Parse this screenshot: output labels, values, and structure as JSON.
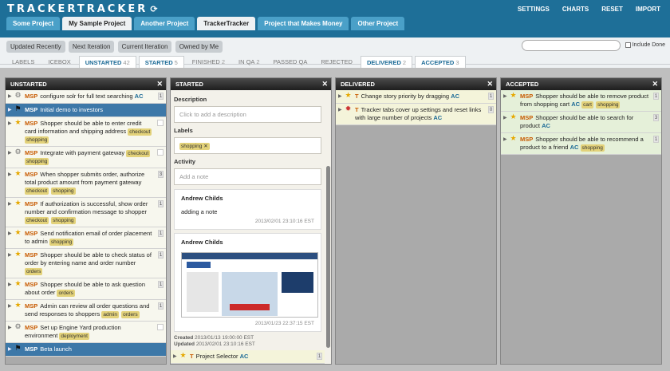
{
  "app": {
    "logo": "TRACKERTRACKER",
    "refresh_icon": "refresh-icon"
  },
  "toplinks": [
    "SETTINGS",
    "CHARTS",
    "RESET",
    "IMPORT"
  ],
  "project_tabs": [
    "Some Project",
    "My Sample Project",
    "Another Project",
    "TrackerTracker",
    "Project that Makes Money",
    "Other Project"
  ],
  "toolbar": [
    "Updated Recently",
    "Next Iteration",
    "Current Iteration",
    "Owned by Me"
  ],
  "include_done": "Include Done",
  "panel_tabs": [
    {
      "label": "LABELS",
      "count": ""
    },
    {
      "label": "ICEBOX",
      "count": ""
    },
    {
      "label": "UNSTARTED",
      "count": "42"
    },
    {
      "label": "STARTED",
      "count": "5"
    },
    {
      "label": "FINISHED",
      "count": "2"
    },
    {
      "label": "IN QA",
      "count": "2"
    },
    {
      "label": "PASSED QA",
      "count": ""
    },
    {
      "label": "REJECTED",
      "count": ""
    },
    {
      "label": "DELIVERED",
      "count": "2"
    },
    {
      "label": "ACCEPTED",
      "count": "3"
    }
  ],
  "panels": {
    "unstarted": "UNSTARTED",
    "started": "STARTED",
    "delivered": "DELIVERED",
    "accepted": "ACCEPTED"
  },
  "unstarted": [
    {
      "type": "gear",
      "pre": "MSP",
      "text": "configure solr for full text searching",
      "owner": "AC",
      "labels": [],
      "est": "1"
    },
    {
      "type": "flag",
      "pre": "MSP",
      "text": "Initial demo to investors",
      "owner": "",
      "labels": [],
      "est": "",
      "release": true
    },
    {
      "type": "star",
      "pre": "MSP",
      "text": "Shopper should be able to enter credit card information and shipping address",
      "owner": "",
      "labels": [
        "checkout",
        "shopping"
      ],
      "est": ""
    },
    {
      "type": "gear",
      "pre": "MSP",
      "text": "Integrate with payment gateway",
      "owner": "",
      "labels": [
        "checkout",
        "shopping"
      ],
      "est": ""
    },
    {
      "type": "star",
      "pre": "MSP",
      "text": "When shopper submits order, authorize total product amount from payment gateway",
      "owner": "",
      "labels": [
        "checkout",
        "shopping"
      ],
      "est": "3"
    },
    {
      "type": "star",
      "pre": "MSP",
      "text": "If authorization is successful, show order number and confirmation message to shopper",
      "owner": "",
      "labels": [
        "checkout",
        "shopping"
      ],
      "est": "1"
    },
    {
      "type": "star",
      "pre": "MSP",
      "text": "Send notification email of order placement to admin",
      "owner": "",
      "labels": [
        "shopping"
      ],
      "est": "1"
    },
    {
      "type": "star",
      "pre": "MSP",
      "text": "Shopper should be able to check status of order by entering name and order number",
      "owner": "",
      "labels": [
        "orders"
      ],
      "est": "1"
    },
    {
      "type": "star",
      "pre": "MSP",
      "text": "Shopper should be able to ask question about order",
      "owner": "",
      "labels": [
        "orders"
      ],
      "est": "1"
    },
    {
      "type": "star",
      "pre": "MSP",
      "text": "Admin can review all order questions and send responses to shoppers",
      "owner": "",
      "labels": [
        "admin",
        "orders"
      ],
      "est": "1"
    },
    {
      "type": "gear",
      "pre": "MSP",
      "text": "Set up Engine Yard production environment",
      "owner": "",
      "labels": [
        "deployment"
      ],
      "est": ""
    },
    {
      "type": "flag",
      "pre": "MSP",
      "text": "Beta launch",
      "owner": "",
      "labels": [],
      "est": "",
      "release": true
    }
  ],
  "started": {
    "description_label": "Description",
    "description_placeholder": "Click to add a description",
    "labels_label": "Labels",
    "label_tag": "shopping",
    "activity_label": "Activity",
    "note_placeholder": "Add a note",
    "notes": [
      {
        "name": "Andrew Childs",
        "text": "adding a note",
        "ts": "2013/02/01 23:10:16 EST"
      },
      {
        "name": "Andrew Childs",
        "text": "",
        "ts": "2013/01/23 22:37:15 EST"
      }
    ],
    "created_label": "Created",
    "created": "2013/01/13 19:00:00 EST",
    "updated_label": "Updated",
    "updated": "2013/02/01 23:10:16 EST",
    "story": {
      "type": "star",
      "pre": "T",
      "text": "Project Selector",
      "owner": "AC",
      "est": "1"
    }
  },
  "delivered": [
    {
      "type": "star",
      "pre": "T",
      "text": "Change story priority by dragging",
      "owner": "AC",
      "labels": [],
      "est": "1"
    },
    {
      "type": "bug",
      "pre": "T",
      "text": "Tracker tabs cover up settings and reset links with large number of projects",
      "owner": "AC",
      "labels": [],
      "est": "0"
    }
  ],
  "accepted": [
    {
      "type": "star",
      "pre": "MSP",
      "text": "Shopper should be able to remove product from shopping cart",
      "owner": "AC",
      "labels": [
        "cart",
        "shopping"
      ],
      "est": "1"
    },
    {
      "type": "star",
      "pre": "MSP",
      "text": "Shopper should be able to search for product",
      "owner": "AC",
      "labels": [],
      "est": "3"
    },
    {
      "type": "star",
      "pre": "MSP",
      "text": "Shopper should be able to recommend a product to a friend",
      "owner": "AC",
      "labels": [
        "shopping"
      ],
      "est": "1"
    }
  ]
}
